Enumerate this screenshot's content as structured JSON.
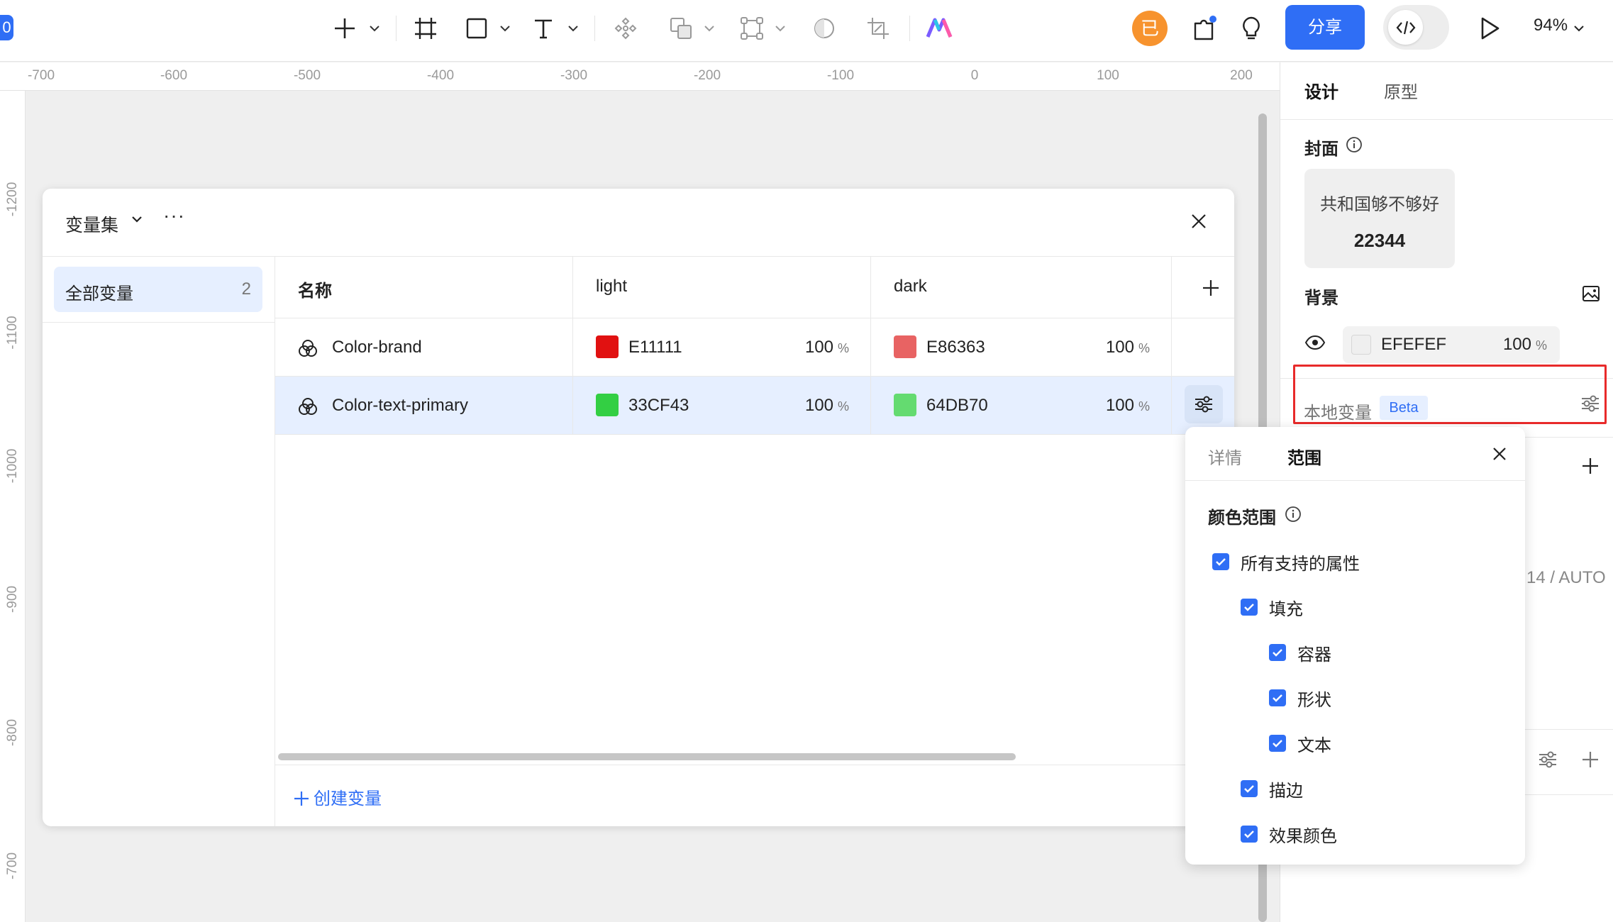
{
  "toolbar": {
    "left_badge": "0",
    "avatar_letter": "已",
    "share_label": "分享",
    "zoom": "94%"
  },
  "ruler": {
    "top_ticks": [
      "-700",
      "-600",
      "-500",
      "-400",
      "-300",
      "-200",
      "-100",
      "0",
      "100",
      "200"
    ],
    "left_ticks": [
      "-1200",
      "-1100",
      "-1000",
      "-900",
      "-800",
      "-700"
    ]
  },
  "variables_panel": {
    "title": "变量集",
    "more": "···",
    "sidebar": {
      "item_label": "全部变量",
      "item_count": "2"
    },
    "columns": {
      "name": "名称",
      "mode1": "light",
      "mode2": "dark"
    },
    "rows": [
      {
        "name": "Color-brand",
        "light": {
          "hex": "E11111",
          "opacity": "100",
          "color": "#E11111"
        },
        "dark": {
          "hex": "E86363",
          "opacity": "100",
          "color": "#E86363"
        }
      },
      {
        "name": "Color-text-primary",
        "light": {
          "hex": "33CF43",
          "opacity": "100",
          "color": "#33CF43"
        },
        "dark": {
          "hex": "64DB70",
          "opacity": "100",
          "color": "#64DB70"
        }
      }
    ],
    "percent_sign": "%",
    "create_label": "创建变量"
  },
  "right_panel": {
    "tabs": [
      "设计",
      "原型"
    ],
    "cover_label": "封面",
    "cover_card": {
      "title": "共和国够不够好",
      "number": "22344"
    },
    "background_label": "背景",
    "background": {
      "hex": "EFEFEF",
      "opacity": "100",
      "percent_sign": "%"
    },
    "local_variables_label": "本地变量",
    "beta_label": "Beta",
    "partial_value": "14 / AUTO"
  },
  "scope_popover": {
    "tabs": [
      "详情",
      "范围"
    ],
    "section_title": "颜色范围",
    "options": [
      {
        "label": "所有支持的属性",
        "checked": true
      },
      {
        "label": "填充",
        "checked": true
      },
      {
        "label": "容器",
        "checked": true
      },
      {
        "label": "形状",
        "checked": true
      },
      {
        "label": "文本",
        "checked": true
      },
      {
        "label": "描边",
        "checked": true
      },
      {
        "label": "效果颜色",
        "checked": true
      }
    ]
  },
  "colors": {
    "accent": "#2F6EF5",
    "avatar": "#F7932E",
    "highlight_box": "#E82A2A"
  }
}
